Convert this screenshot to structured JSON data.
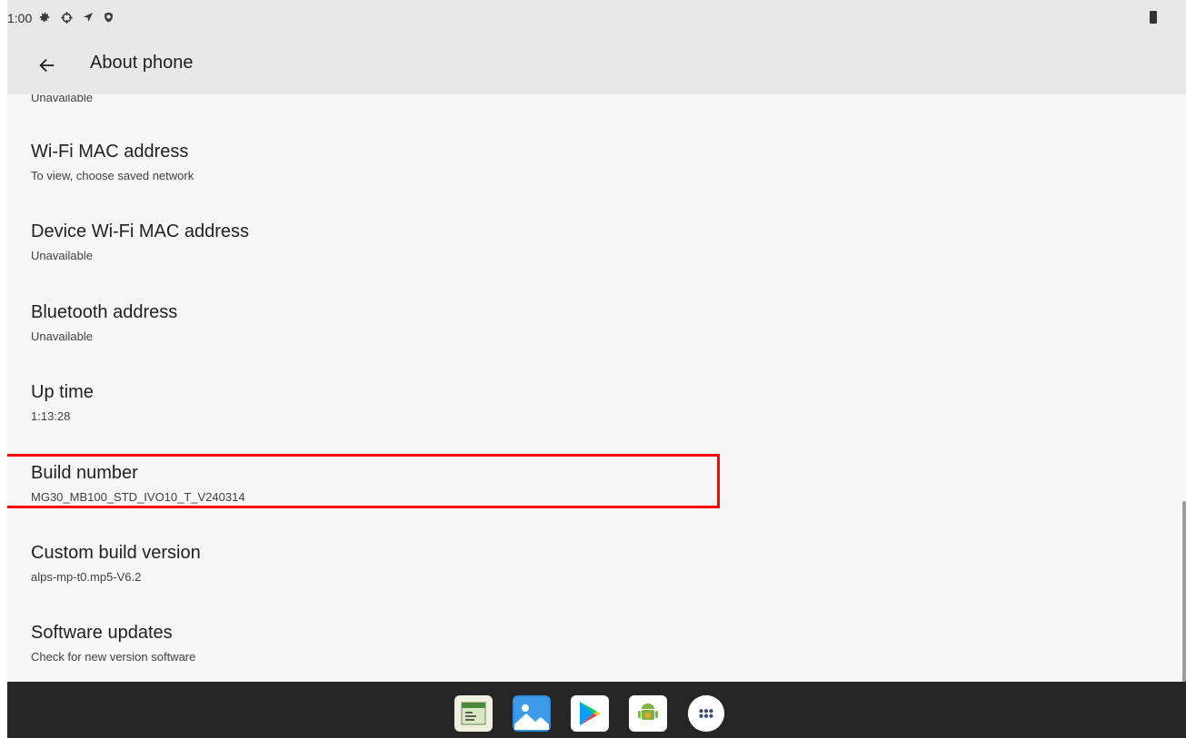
{
  "status_bar": {
    "time": "1:00",
    "icons": [
      "settings-gear-icon",
      "crosshair-icon",
      "location-arrow-icon",
      "shield-icon",
      "battery-icon"
    ]
  },
  "app_bar": {
    "title": "About phone",
    "back_icon": "back-arrow-icon"
  },
  "list": {
    "partial_summary_top": "Unavailable",
    "items": [
      {
        "title": "Wi-Fi MAC address",
        "summary": "To view, choose saved network"
      },
      {
        "title": "Device Wi-Fi MAC address",
        "summary": "Unavailable"
      },
      {
        "title": "Bluetooth address",
        "summary": "Unavailable"
      },
      {
        "title": "Up time",
        "summary": "1:13:28"
      },
      {
        "title": "Build number",
        "summary": "MG30_MB100_STD_IVO10_T_V240314",
        "highlighted": true
      },
      {
        "title": "Custom build version",
        "summary": "alps-mp-t0.mp5-V6.2"
      },
      {
        "title": "Software updates",
        "summary": "Check for new version software"
      }
    ]
  },
  "taskbar": {
    "apps": [
      "tool-app-icon",
      "gallery-app-icon",
      "play-store-icon",
      "android-app-icon",
      "all-apps-icon"
    ]
  },
  "colors": {
    "highlight_border": "#ff0000",
    "header_background": "#e8e8e8",
    "taskbar_background": "#262626"
  }
}
